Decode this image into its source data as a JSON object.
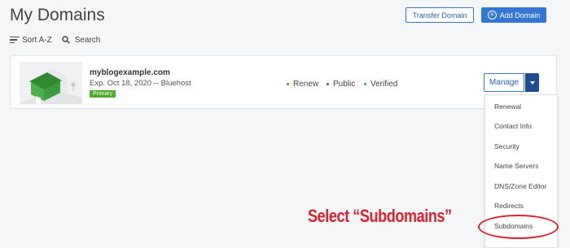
{
  "header": {
    "title": "My Domains",
    "transfer_label": "Transfer Domain",
    "add_label": "Add Domain",
    "accent": "#3575d3"
  },
  "toolbar": {
    "sort_label": "Sort A-Z",
    "search_label": "Search"
  },
  "domain": {
    "name": "myblogexample.com",
    "expiry": "Exp. Oct 18, 2020 -- Bluehost",
    "badge": "Primary",
    "statuses": [
      {
        "label": "Renew",
        "color": "#4caa2b"
      },
      {
        "label": "Public",
        "color": "#d0303a"
      },
      {
        "label": "Verified",
        "color": "#4caa2b"
      }
    ]
  },
  "manage": {
    "label": "Manage",
    "menu": [
      "Renewal",
      "Contact Info",
      "Security",
      "Name Servers",
      "DNS/Zone Editor",
      "Redirects",
      "Subdomains"
    ]
  },
  "annotation": {
    "text": "Select “Subdomains”",
    "color": "#e02030"
  }
}
